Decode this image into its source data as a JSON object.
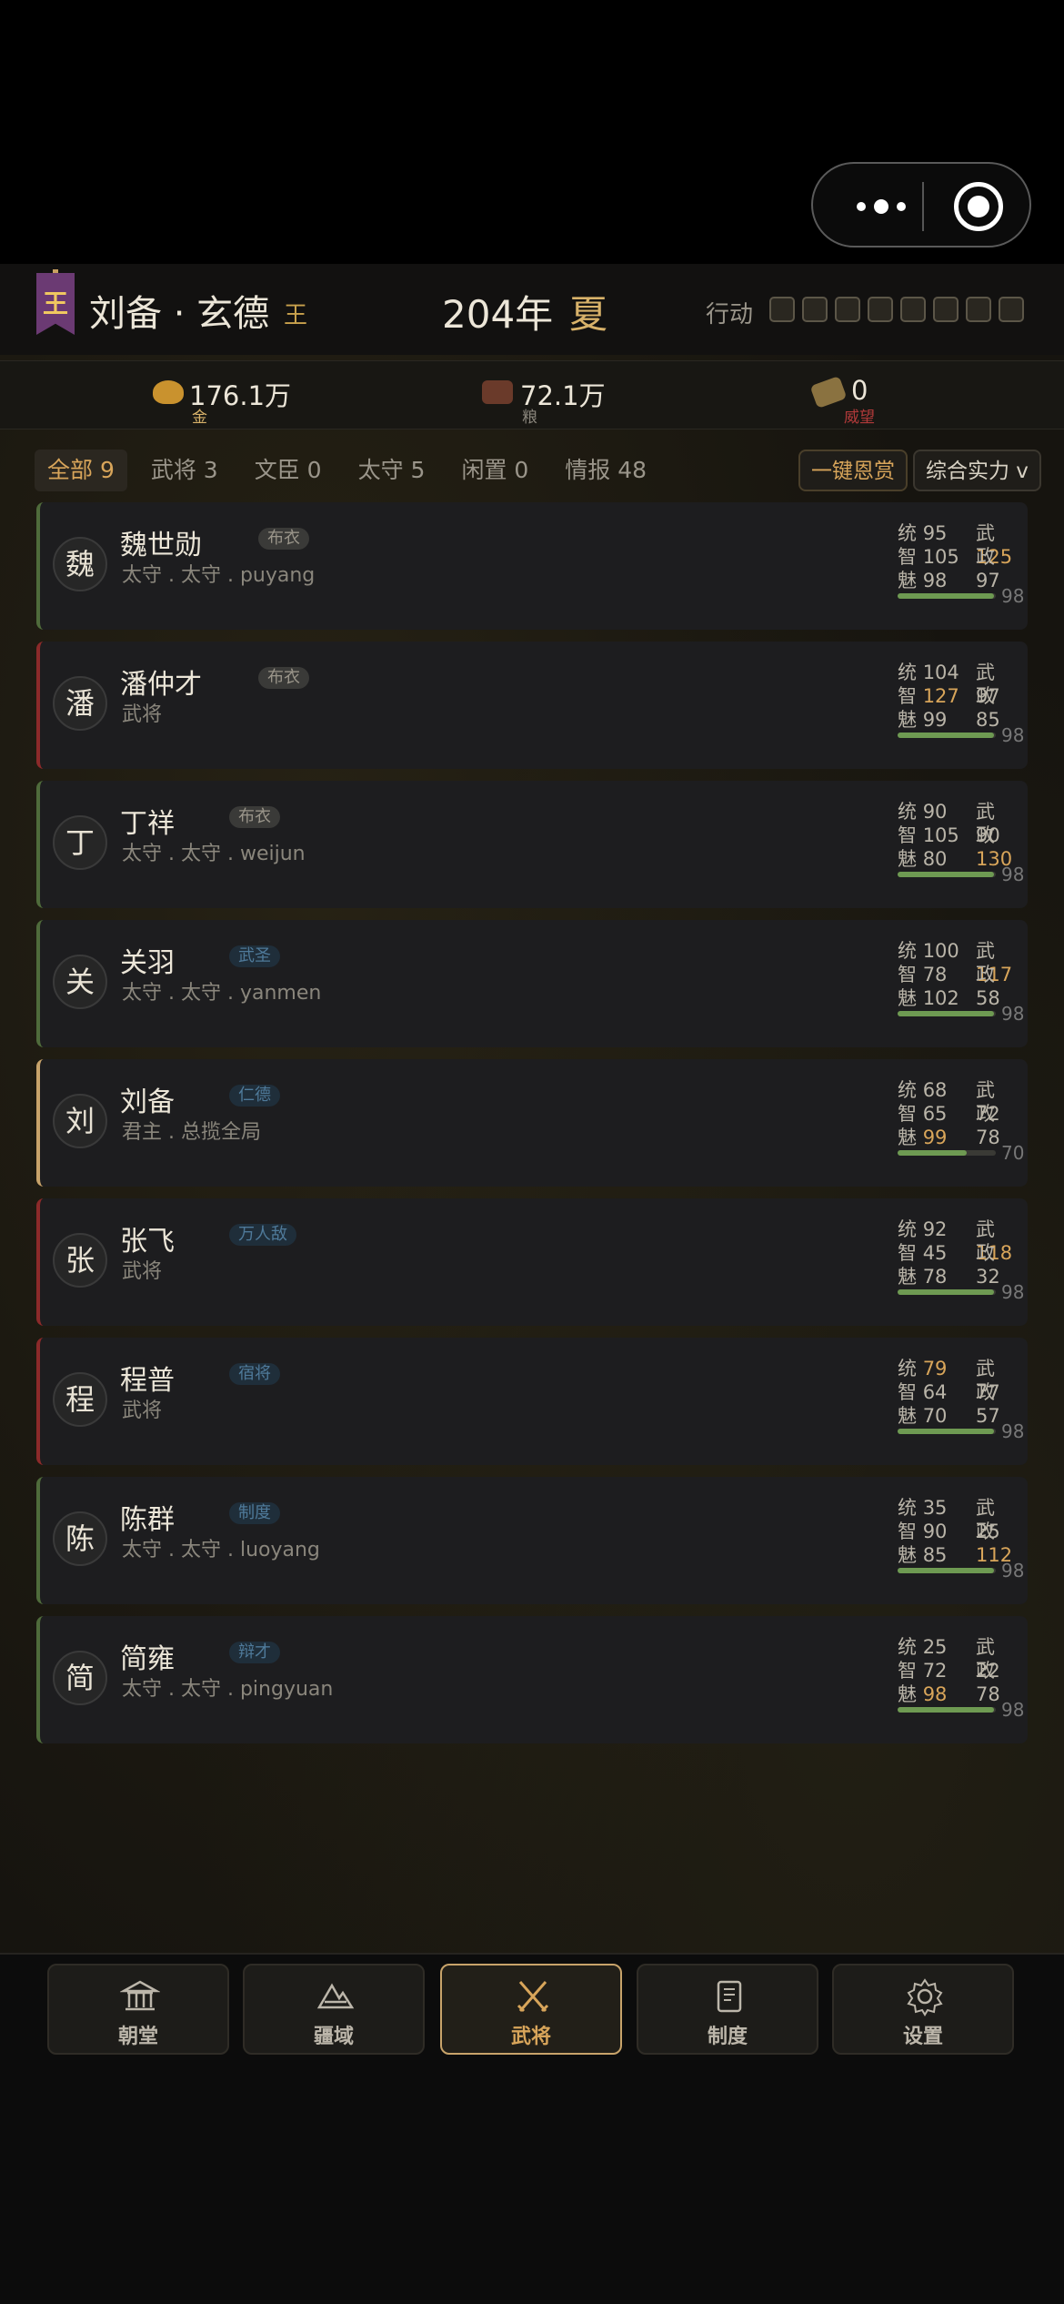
{
  "header": {
    "ruler_name": "刘备 · 玄德",
    "ruler_title": "王",
    "banner_char": "王",
    "year": "204年",
    "season": "夏",
    "action_label": "行动"
  },
  "resources": [
    {
      "value": "176.1万",
      "label": "金",
      "icon": "gold-ingot-icon",
      "color": "#d8b26a"
    },
    {
      "value": "72.1万",
      "label": "粮",
      "icon": "granary-icon",
      "color": "#8a867c"
    },
    {
      "value": "0",
      "label": "威望",
      "icon": "prestige-icon",
      "color": "#b23a3a"
    }
  ],
  "filters": {
    "tabs": [
      "全部 9",
      "武将 3",
      "文臣 0",
      "太守 5",
      "闲置 0",
      "情报 48"
    ],
    "reward_button": "一键恩赏",
    "sort_button": "综合实力 v"
  },
  "generals": [
    {
      "avatar": "魏",
      "name": "魏世勋",
      "tag": "布衣",
      "role": "太守 . 太守 . puyang",
      "tong_l": "统",
      "tong": "95",
      "wu_l": "武",
      "wu": "125",
      "zhi_l": "智",
      "zhi": "105",
      "zheng_l": "政",
      "zheng": "97",
      "mei_l": "魅",
      "mei": "98",
      "score": "98"
    },
    {
      "avatar": "潘",
      "name": "潘仲才",
      "tag": "布衣",
      "role": "武将",
      "tong_l": "统",
      "tong": "104",
      "wu_l": "武",
      "wu": "97",
      "zhi_l": "智",
      "zhi": "127",
      "zheng_l": "政",
      "zheng": "85",
      "mei_l": "魅",
      "mei": "99",
      "score": "98"
    },
    {
      "avatar": "丁",
      "name": "丁祥",
      "tag": "布衣",
      "role": "太守 . 太守 . weijun",
      "tong_l": "统",
      "tong": "90",
      "wu_l": "武",
      "wu": "90",
      "zhi_l": "智",
      "zhi": "105",
      "zheng_l": "政",
      "zheng": "130",
      "mei_l": "魅",
      "mei": "80",
      "score": "98"
    },
    {
      "avatar": "关",
      "name": "关羽",
      "tag": "武圣",
      "role": "太守 . 太守 . yanmen",
      "tong_l": "统",
      "tong": "100",
      "wu_l": "武",
      "wu": "117",
      "zhi_l": "智",
      "zhi": "78",
      "zheng_l": "政",
      "zheng": "58",
      "mei_l": "魅",
      "mei": "102",
      "score": "98"
    },
    {
      "avatar": "刘",
      "name": "刘备",
      "tag": "仁德",
      "role": "君主 . 总揽全局",
      "tong_l": "统",
      "tong": "68",
      "wu_l": "武",
      "wu": "72",
      "zhi_l": "智",
      "zhi": "65",
      "zheng_l": "政",
      "zheng": "78",
      "mei_l": "魅",
      "mei": "99",
      "score": "70"
    },
    {
      "avatar": "张",
      "name": "张飞",
      "tag": "万人敌",
      "role": "武将",
      "tong_l": "统",
      "tong": "92",
      "wu_l": "武",
      "wu": "118",
      "zhi_l": "智",
      "zhi": "45",
      "zheng_l": "政",
      "zheng": "32",
      "mei_l": "魅",
      "mei": "78",
      "score": "98"
    },
    {
      "avatar": "程",
      "name": "程普",
      "tag": "宿将",
      "role": "武将",
      "tong_l": "统",
      "tong": "79",
      "wu_l": "武",
      "wu": "77",
      "zhi_l": "智",
      "zhi": "64",
      "zheng_l": "政",
      "zheng": "57",
      "mei_l": "魅",
      "mei": "70",
      "score": "98"
    },
    {
      "avatar": "陈",
      "name": "陈群",
      "tag": "制度",
      "role": "太守 . 太守 . luoyang",
      "tong_l": "统",
      "tong": "35",
      "wu_l": "武",
      "wu": "25",
      "zhi_l": "智",
      "zhi": "90",
      "zheng_l": "政",
      "zheng": "112",
      "mei_l": "魅",
      "mei": "85",
      "score": "98"
    },
    {
      "avatar": "简",
      "name": "简雍",
      "tag": "辩才",
      "role": "太守 . 太守 . pingyuan",
      "tong_l": "统",
      "tong": "25",
      "wu_l": "武",
      "wu": "22",
      "zhi_l": "智",
      "zhi": "72",
      "zheng_l": "政",
      "zheng": "78",
      "mei_l": "魅",
      "mei": "98",
      "score": "98"
    }
  ],
  "nav": [
    {
      "label": "朝堂",
      "icon": "court-icon"
    },
    {
      "label": "疆域",
      "icon": "territory-icon"
    },
    {
      "label": "武将",
      "icon": "crossed-swords-icon"
    },
    {
      "label": "制度",
      "icon": "scroll-icon"
    },
    {
      "label": "设置",
      "icon": "gear-icon"
    }
  ],
  "colors": {
    "accent": "#d8a55a",
    "good": "#6e9a52",
    "danger": "#8c2a2a"
  }
}
